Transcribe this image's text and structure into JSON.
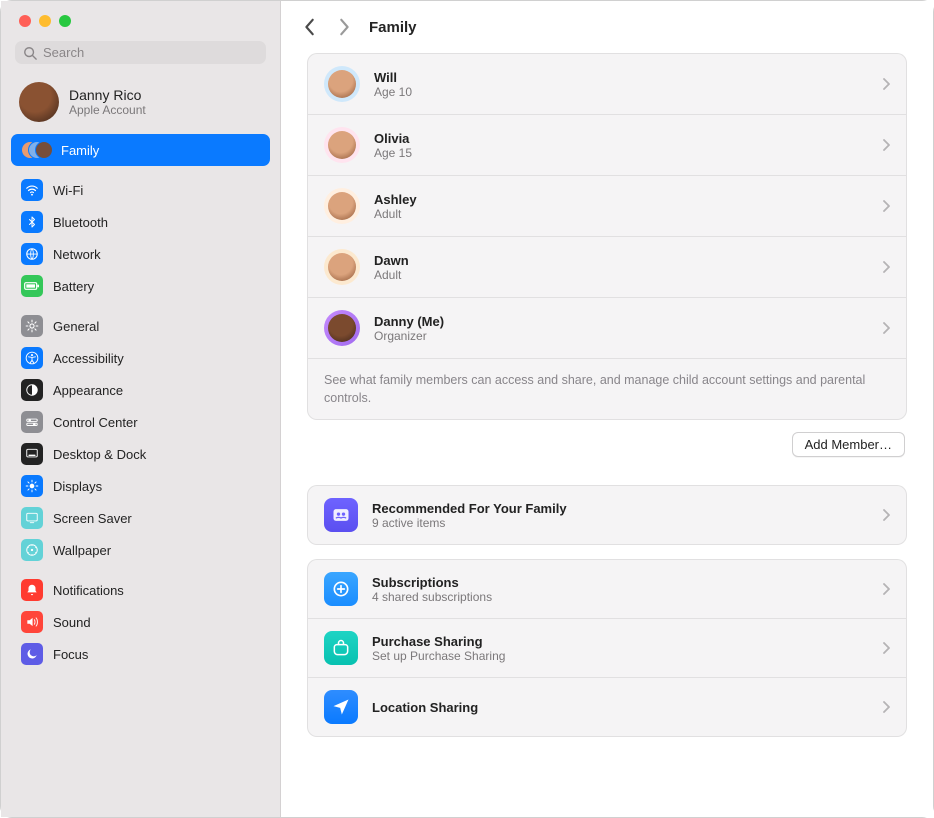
{
  "search": {
    "placeholder": "Search"
  },
  "account": {
    "name": "Danny Rico",
    "sub": "Apple Account"
  },
  "sidebar": {
    "family_label": "Family",
    "g1": [
      {
        "label": "Wi-Fi"
      },
      {
        "label": "Bluetooth"
      },
      {
        "label": "Network"
      },
      {
        "label": "Battery"
      }
    ],
    "g2": [
      {
        "label": "General"
      },
      {
        "label": "Accessibility"
      },
      {
        "label": "Appearance"
      },
      {
        "label": "Control Center"
      },
      {
        "label": "Desktop & Dock"
      },
      {
        "label": "Displays"
      },
      {
        "label": "Screen Saver"
      },
      {
        "label": "Wallpaper"
      }
    ],
    "g3": [
      {
        "label": "Notifications"
      },
      {
        "label": "Sound"
      },
      {
        "label": "Focus"
      }
    ]
  },
  "page": {
    "title": "Family"
  },
  "members": [
    {
      "name": "Will",
      "sub": "Age 10"
    },
    {
      "name": "Olivia",
      "sub": "Age 15"
    },
    {
      "name": "Ashley",
      "sub": "Adult"
    },
    {
      "name": "Dawn",
      "sub": "Adult"
    },
    {
      "name": "Danny (Me)",
      "sub": "Organizer"
    }
  ],
  "members_footer": "See what family members can access and share, and manage child account settings and parental controls.",
  "add_member_label": "Add Member…",
  "recommended": {
    "title": "Recommended For Your Family",
    "sub": "9 active items"
  },
  "options": [
    {
      "title": "Subscriptions",
      "sub": "4 shared subscriptions"
    },
    {
      "title": "Purchase Sharing",
      "sub": "Set up Purchase Sharing"
    },
    {
      "title": "Location Sharing",
      "sub": ""
    }
  ]
}
